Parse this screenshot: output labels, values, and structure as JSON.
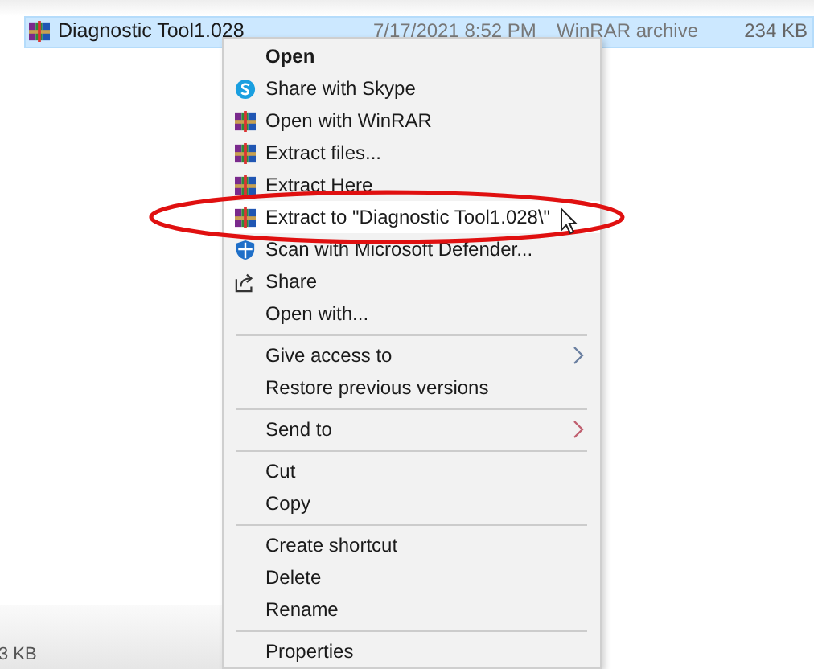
{
  "file_row": {
    "name": "Diagnostic Tool1.028",
    "date": "7/17/2021 8:52 PM",
    "type": "WinRAR archive",
    "size": "234 KB",
    "selected": true
  },
  "context_menu": [
    {
      "kind": "item",
      "label": "Open",
      "bold": true,
      "selected": false
    },
    {
      "kind": "skype",
      "label": "Share with Skype",
      "selected": false
    },
    {
      "kind": "archive",
      "label": "Open with WinRAR",
      "selected": false
    },
    {
      "kind": "archive",
      "label": "Extract files...",
      "selected": false
    },
    {
      "kind": "archive",
      "label": "Extract Here",
      "selected": false
    },
    {
      "kind": "archive",
      "label": "Extract to \"Diagnostic Tool1.028\\\"",
      "selected": true
    },
    {
      "kind": "shield",
      "label": "Scan with Microsoft Defender...",
      "selected": false
    },
    {
      "kind": "share",
      "label": "Share",
      "selected": false
    },
    {
      "kind": "item",
      "label": "Open with...",
      "selected": false
    },
    {
      "kind": "separator"
    },
    {
      "kind": "item",
      "label": "Give access to",
      "submenu": true,
      "selected": false
    },
    {
      "kind": "item",
      "label": "Restore previous versions",
      "selected": false
    },
    {
      "kind": "separator"
    },
    {
      "kind": "item",
      "label": "Send to",
      "submenu": true,
      "selected": false
    },
    {
      "kind": "separator"
    },
    {
      "kind": "item",
      "label": "Cut",
      "selected": false
    },
    {
      "kind": "item",
      "label": "Copy",
      "selected": false
    },
    {
      "kind": "separator"
    },
    {
      "kind": "item",
      "label": "Create shortcut",
      "selected": false
    },
    {
      "kind": "item",
      "label": "Delete",
      "selected": false
    },
    {
      "kind": "item",
      "label": "Rename",
      "selected": false
    },
    {
      "kind": "separator"
    },
    {
      "kind": "item",
      "label": "Properties",
      "selected": false
    }
  ],
  "status_size": "3 KB"
}
